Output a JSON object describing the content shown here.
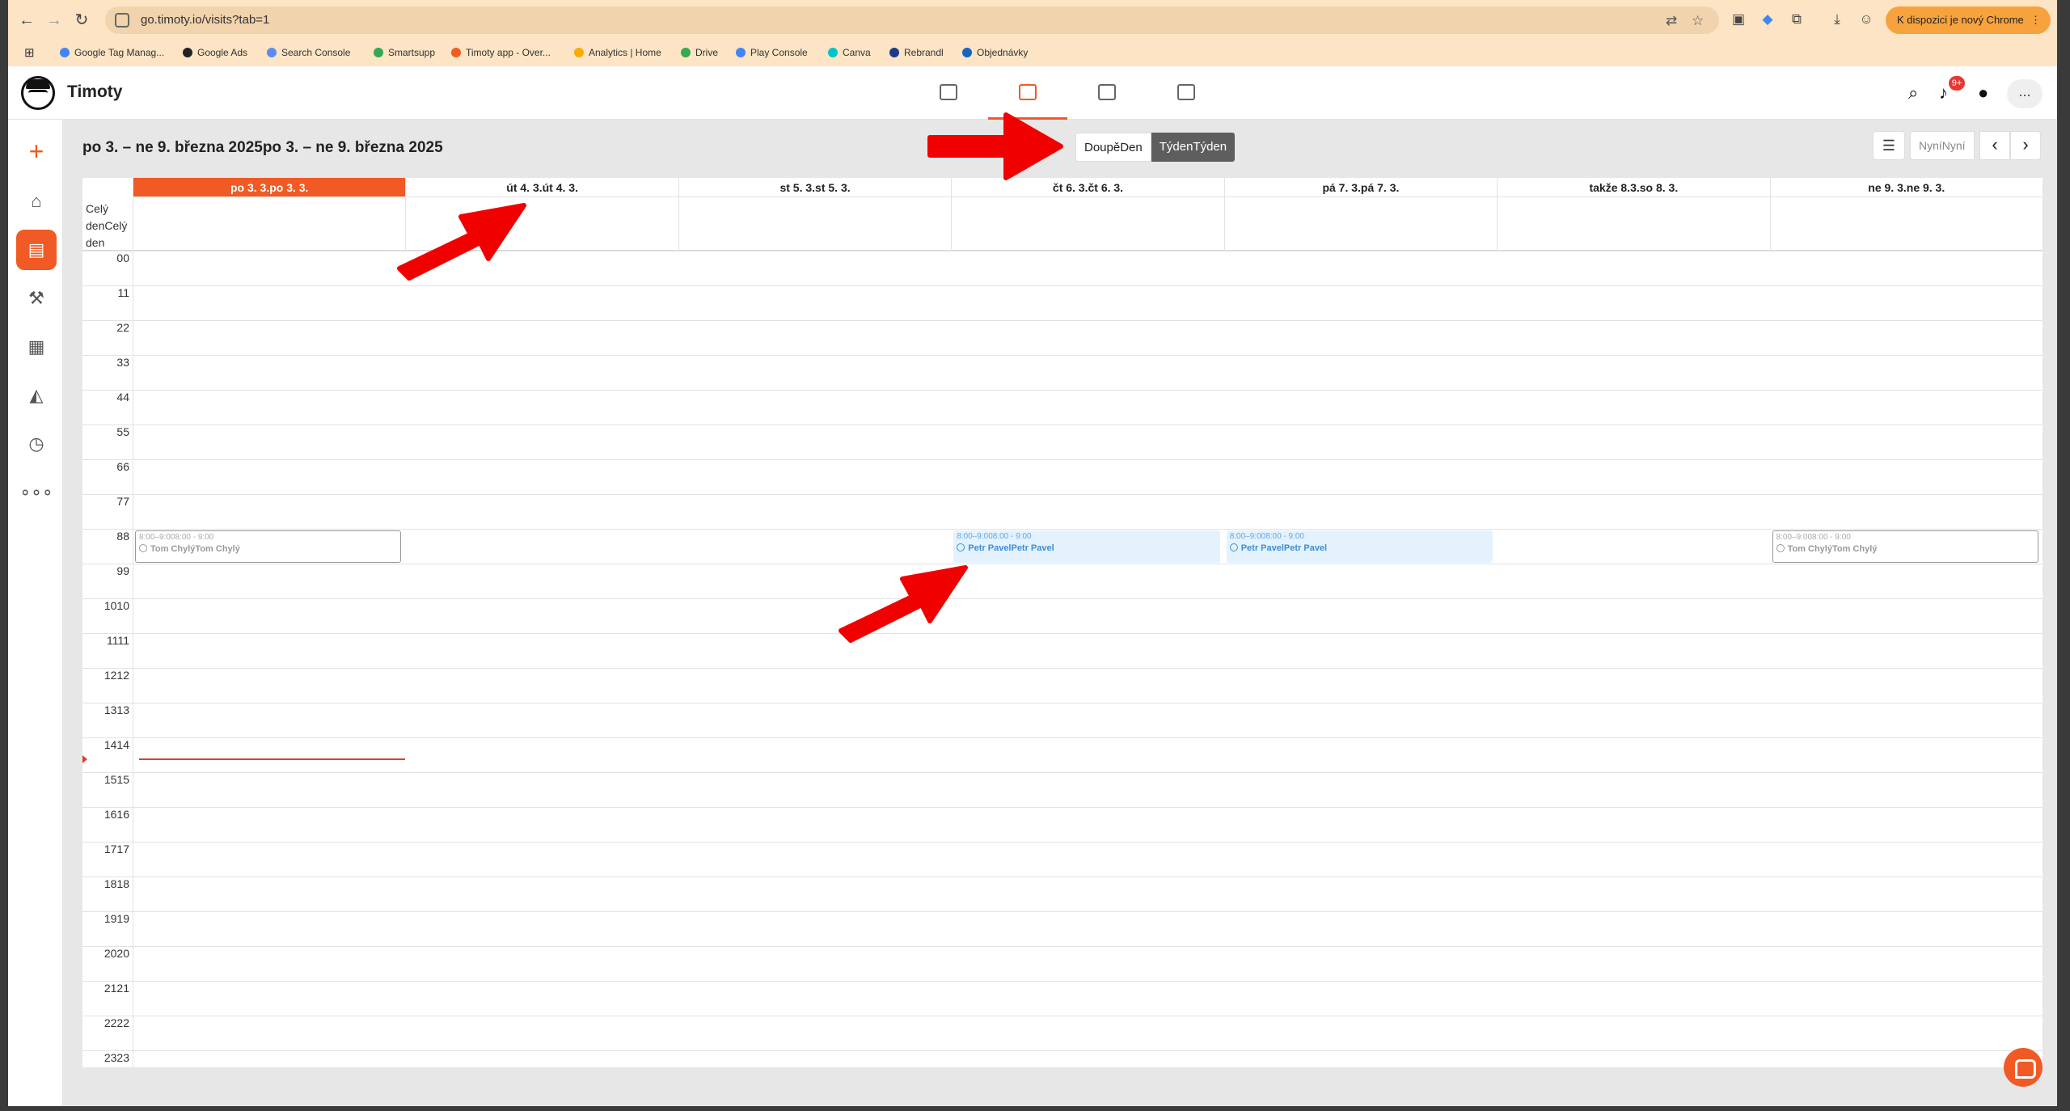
{
  "browser": {
    "url": "go.timoty.io/visits?tab=1",
    "update_label": "K dispozici je nový Chrome",
    "bookmarks": [
      {
        "label": "Google Tag Manag...",
        "color": "#4285f4"
      },
      {
        "label": "Google Ads",
        "color": "#222222"
      },
      {
        "label": "Search Console",
        "color": "#5b8def"
      },
      {
        "label": "Smartsupp",
        "color": "#34a853"
      },
      {
        "label": "Timoty app - Over...",
        "color": "#f15a24"
      },
      {
        "label": "Analytics | Home",
        "color": "#f9ab00"
      },
      {
        "label": "Drive",
        "color": "#34a853"
      },
      {
        "label": "Play Console",
        "color": "#4285f4"
      },
      {
        "label": "Canva",
        "color": "#00c4cc"
      },
      {
        "label": "Rebrandl",
        "color": "#1a3c8a"
      },
      {
        "label": "Objednávky",
        "color": "#1565c0"
      }
    ]
  },
  "app": {
    "title": "Timoty",
    "notif_count": "9+",
    "more_label": "...",
    "accent": "#f15a24"
  },
  "toolbar": {
    "range_title": "po 3. – ne 9. března 2025po 3. – ne 9. března 2025",
    "day_label": "DoupěDen",
    "week_label": "TýdenTýden",
    "now_label": "NyníNyní",
    "prev_icon": "‹",
    "next_icon": "›"
  },
  "calendar": {
    "allday_label": "Celý denCelý den",
    "days": [
      {
        "label": "po 3. 3.po 3. 3.",
        "today": true
      },
      {
        "label": "út 4. 3.út 4. 3.",
        "today": false
      },
      {
        "label": "st 5. 3.st 5. 3.",
        "today": false
      },
      {
        "label": "čt 6. 3.čt 6. 3.",
        "today": false
      },
      {
        "label": "pá 7. 3.pá 7. 3.",
        "today": false
      },
      {
        "label": "takže 8.3.so 8. 3.",
        "today": false
      },
      {
        "label": "ne 9. 3.ne 9. 3.",
        "today": false
      }
    ],
    "hours": [
      "00",
      "11",
      "22",
      "33",
      "44",
      "55",
      "66",
      "77",
      "88",
      "99",
      "1010",
      "1111",
      "1212",
      "1313",
      "1414",
      "1515",
      "1616",
      "1717",
      "1818",
      "1919",
      "2020",
      "2121",
      "2222",
      "2323"
    ],
    "events": [
      {
        "day": 0,
        "hour": 8,
        "time": "8:00–9:008:00 - 9:00",
        "name": "Tom ChylýTom Chylý",
        "style": "ghost"
      },
      {
        "day": 3,
        "hour": 8,
        "time": "8:00–9:008:00 - 9:00",
        "name": "Petr PavelPetr Pavel",
        "style": "blue"
      },
      {
        "day": 4,
        "hour": 8,
        "time": "8:00–9:008:00 - 9:00",
        "name": "Petr PavelPetr Pavel",
        "style": "blue"
      },
      {
        "day": 6,
        "hour": 8,
        "time": "8:00–9:008:00 - 9:00",
        "name": "Tom ChylýTom Chylý",
        "style": "ghost"
      }
    ],
    "now_hour": 14.6
  }
}
